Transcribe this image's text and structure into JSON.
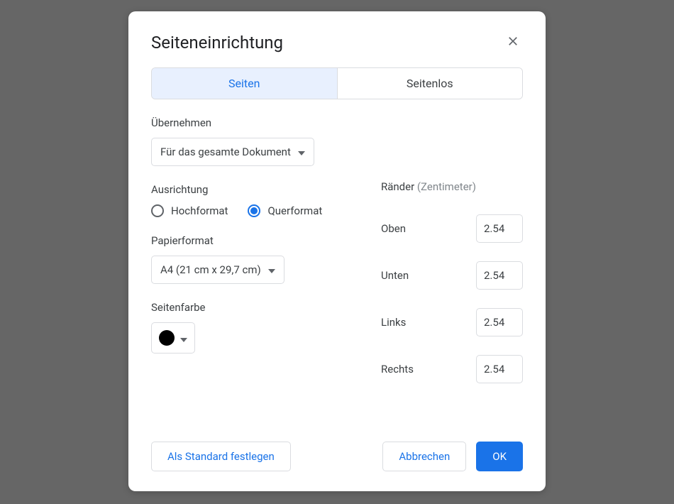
{
  "dialog": {
    "title": "Seiteneinrichtung",
    "tabs": {
      "pages": "Seiten",
      "pageless": "Seitenlos"
    },
    "apply": {
      "label": "Übernehmen",
      "value": "Für das gesamte Dokument"
    },
    "orientation": {
      "label": "Ausrichtung",
      "portrait": "Hochformat",
      "landscape": "Querformat",
      "selected": "landscape"
    },
    "paper": {
      "label": "Papierformat",
      "value": "A4 (21 cm x 29,7 cm)"
    },
    "pageColor": {
      "label": "Seitenfarbe",
      "value": "#000000"
    },
    "margins": {
      "label": "Ränder",
      "unit": "(Zentimeter)",
      "top": {
        "label": "Oben",
        "value": "2.54"
      },
      "bottom": {
        "label": "Unten",
        "value": "2.54"
      },
      "left": {
        "label": "Links",
        "value": "2.54"
      },
      "right": {
        "label": "Rechts",
        "value": "2.54"
      }
    },
    "buttons": {
      "setDefault": "Als Standard festlegen",
      "cancel": "Abbrechen",
      "ok": "OK"
    }
  }
}
